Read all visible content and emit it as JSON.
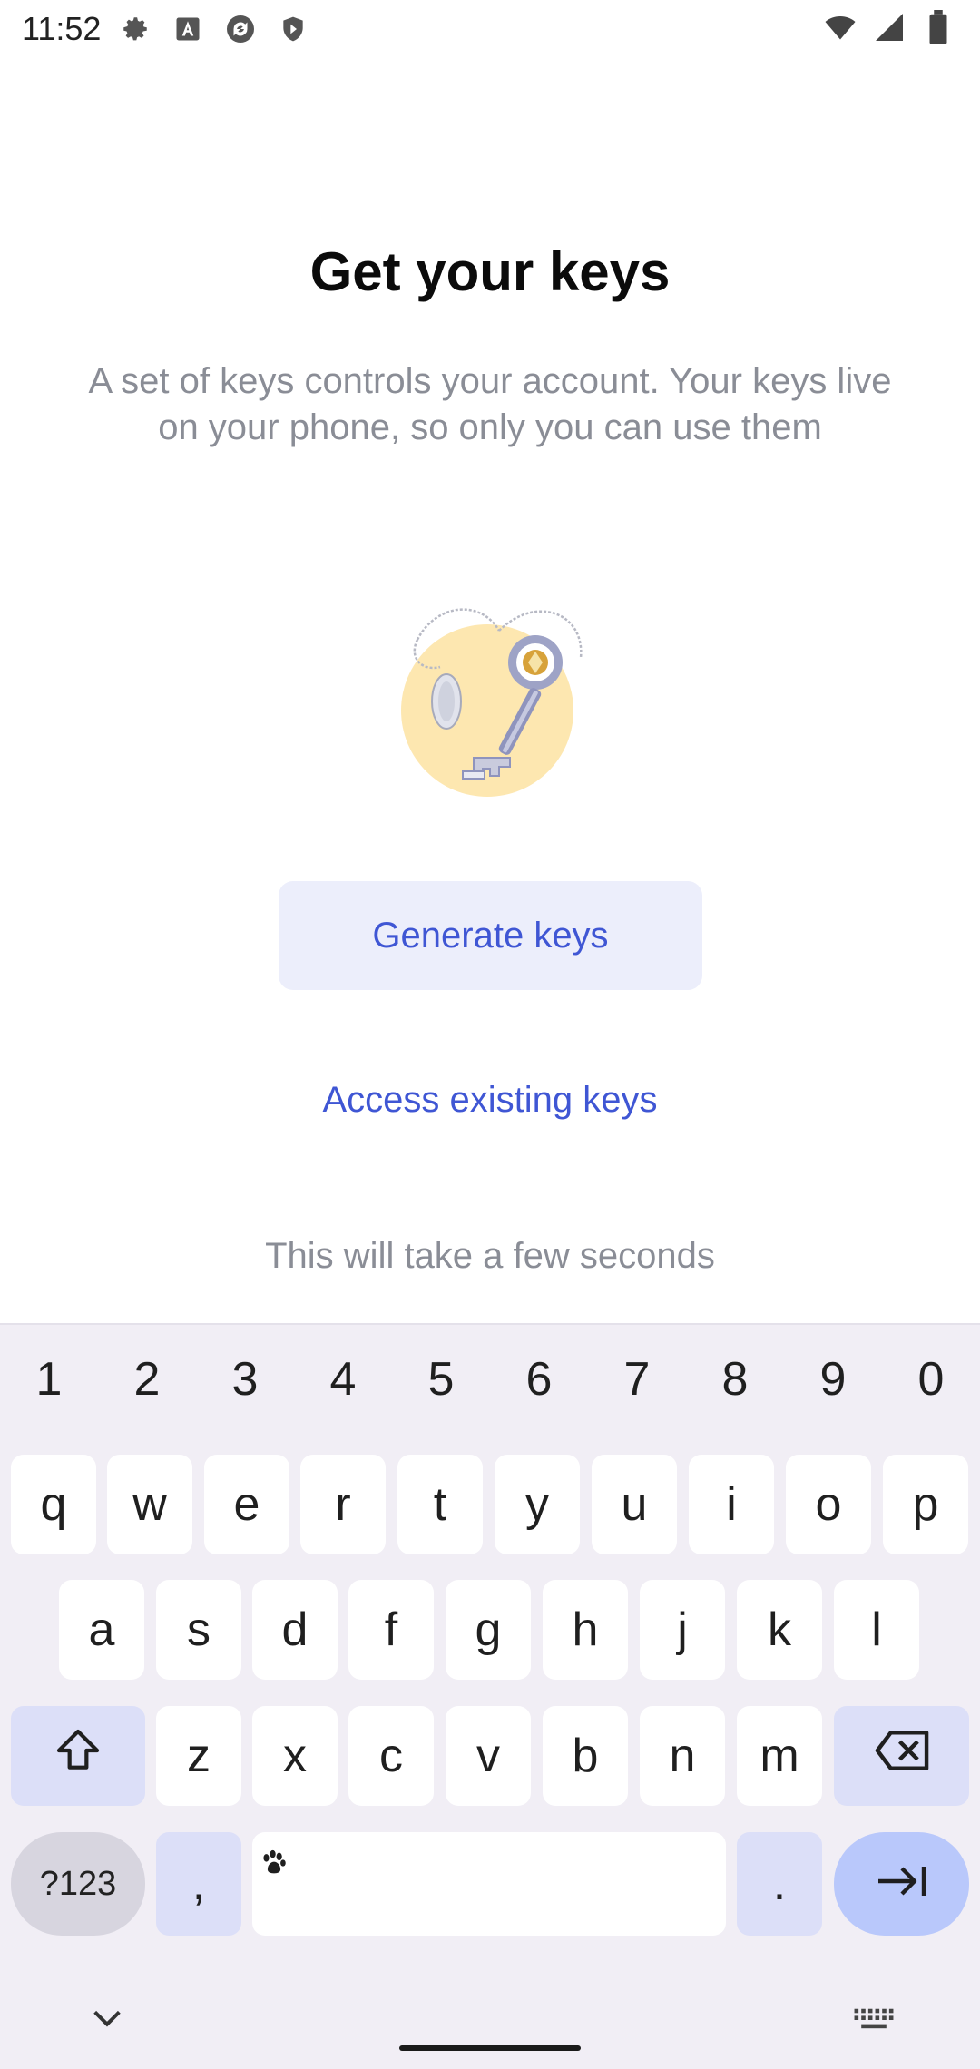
{
  "status_bar": {
    "time": "11:52",
    "left_icons": [
      "gear-icon",
      "font-icon",
      "sync-icon",
      "shield-icon"
    ],
    "right_icons": [
      "wifi-icon",
      "signal-icon",
      "battery-icon"
    ]
  },
  "main": {
    "title": "Get your keys",
    "subtitle": "A set of keys controls your account. Your keys live on your phone, so only you can use them",
    "illustration": "keys-illustration",
    "generate_button": "Generate keys",
    "access_link": "Access existing keys",
    "hint": "This will take a few seconds"
  },
  "colors": {
    "accent": "#3f56d4",
    "button_bg": "#eceefb",
    "muted_text": "#8a8d96",
    "keyboard_bg": "#f1eef5"
  },
  "keyboard": {
    "numbers": [
      "1",
      "2",
      "3",
      "4",
      "5",
      "6",
      "7",
      "8",
      "9",
      "0"
    ],
    "row1": [
      "q",
      "w",
      "e",
      "r",
      "t",
      "y",
      "u",
      "i",
      "o",
      "p"
    ],
    "row2": [
      "a",
      "s",
      "d",
      "f",
      "g",
      "h",
      "j",
      "k",
      "l"
    ],
    "row3": [
      "z",
      "x",
      "c",
      "v",
      "b",
      "n",
      "m"
    ],
    "symbols_key": "?123",
    "comma_key": ",",
    "period_key": ".",
    "shift_icon": "shift-icon",
    "backspace_icon": "backspace-icon",
    "enter_icon": "tab-next-icon",
    "collapse_icon": "chevron-down-icon",
    "switch_keyboard_icon": "keyboard-icon"
  }
}
